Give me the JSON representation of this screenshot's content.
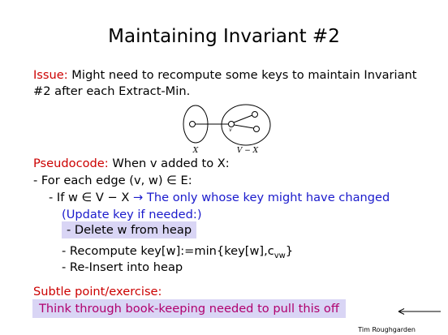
{
  "slide": {
    "title": "Maintaining Invariant #2",
    "issue_label": "Issue:",
    "issue_text_1": " Might need to recompute some keys to maintain Invariant",
    "issue_text_2": "#2 after each Extract-Min.",
    "diagram": {
      "left_label": "X",
      "right_label": "V − X",
      "node_label": "v"
    },
    "pseudocode_label": "Pseudocode:",
    "pseudocode_text": " When v added to X:",
    "line_for_each": "- For each edge (v, w) ∈ E:",
    "line_if": "- If w ∈ V − X",
    "line_if_note": " → The only whose key might have changed",
    "line_update_note": "(Update key if needed:)",
    "line_delete": "Delete w from heap",
    "line_recompute": "- Recompute key[w]:=min{key[w],c",
    "line_recompute_sub": "vw",
    "line_recompute_end": "}",
    "line_reinsert": "- Re-Insert into heap",
    "subtle_label": "Subtle point/exercise:",
    "subtle_text": "Think through book-keeping needed to pull this off",
    "credit": "Tim Roughgarden"
  }
}
